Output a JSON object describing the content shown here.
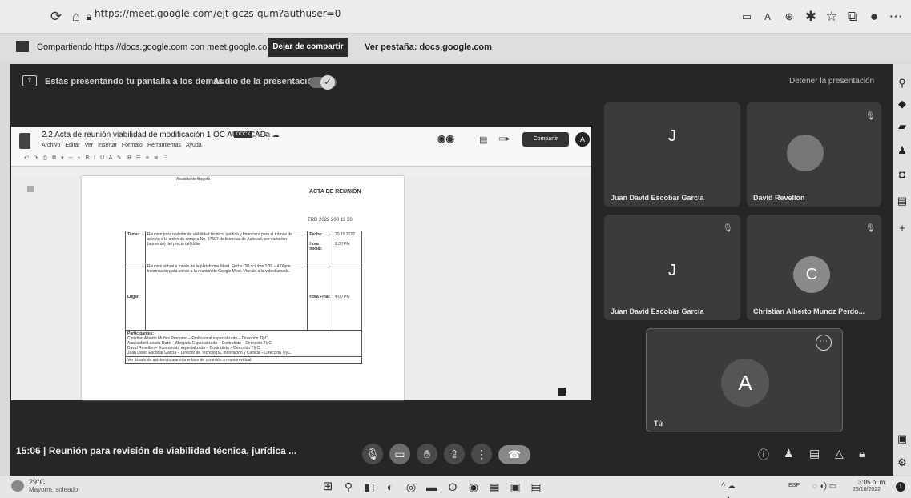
{
  "browser": {
    "url": "https://meet.google.com/ejt-gczs-qum?authuser=0",
    "sharing_text": "Compartiendo https://docs.google.com con meet.google.com",
    "stop_sharing_label": "Dejar de compartir",
    "view_tab_label": "Ver pestaña: docs.google.com"
  },
  "presenting": {
    "banner": "Estás presentando tu pantalla a los demás",
    "audio_label": "Audio de la presentación",
    "stop_label": "Detener la presentación"
  },
  "doc": {
    "title": "2.2 Acta de reunión viabilidad de modificación 1 OC AUTOCAD",
    "badge": "DOCX",
    "menu": [
      "Archivo",
      "Editar",
      "Ver",
      "Insertar",
      "Formato",
      "Herramientas",
      "Ayuda"
    ],
    "share_label": "Compartir",
    "avatar": "A",
    "page_heading_left": "Alcaldía de Bogotá",
    "page_heading_right": "ACTA DE REUNIÓN",
    "radicado": "TRD 2022 200 13 30",
    "table": {
      "tema_label": "Tema:",
      "tema_value": "Reunión para revisión de viabilidad técnica, jurídica y financiera para el trámite de adición a la orden de compra No. 97507 de licencias de Autocad, por variación (aumento) del precio del dólar",
      "fecha_label": "Fecha:",
      "fecha_value": "20.10.2022",
      "hora_inicial_label": "Hora Inicial:",
      "hora_inicial_value": "2:30 PM",
      "lugar_label": "Lugar:",
      "lugar_value": "Reunión virtual a través de la plataforma Meet. Fecha: 20 octubre 2:30 – 4:00pm. Información para unirse a la reunión de Google Meet. Vínculo a la videollamada.",
      "hora_final_label": "Hora Final:",
      "hora_final_value": "4:00 PM",
      "participantes_label": "Participantes:",
      "participantes": [
        "Christian Alberto Muñoz Perdomo – Profesional especializado – Dirección TIyC",
        "Ana Isabel Lozada Rozo – Abogada Especializada – Contratista – Dirección TIyC",
        "David Revellon – Economista especializado – Contratista – Dirección TIyC",
        "Juan David Escobar García – Director de Tecnología, Innovación y Ciencia – Dirección TIyC"
      ],
      "footer": "Ver listado de asistencia anexo a enlace de conexión a reunión virtual"
    }
  },
  "participants": [
    {
      "name": "Juan David Escobar Garcia",
      "initial": "J",
      "avatar_color": "#3b3b3b"
    },
    {
      "name": "David Revellon",
      "initial": "",
      "avatar_color": "#6f6f6f"
    },
    {
      "name": "Juan David Escobar Garcia",
      "initial": "J",
      "avatar_color": "#3b3b3b"
    },
    {
      "name": "Christian Alberto Munoz Perdo...",
      "initial": "C",
      "avatar_color": "#8a8a8a"
    },
    {
      "name": "Tú",
      "initial": "A",
      "avatar_color": "#555555"
    }
  ],
  "meeting": {
    "time": "15:06",
    "separator": "|",
    "title": "Reunión para revisión de viabilidad técnica, jurídica ..."
  },
  "taskbar": {
    "temp": "29°C",
    "weather": "Mayorm. soleado",
    "lang": "ESP",
    "time": "3:05 p. m.",
    "date": "25/10/2022"
  }
}
